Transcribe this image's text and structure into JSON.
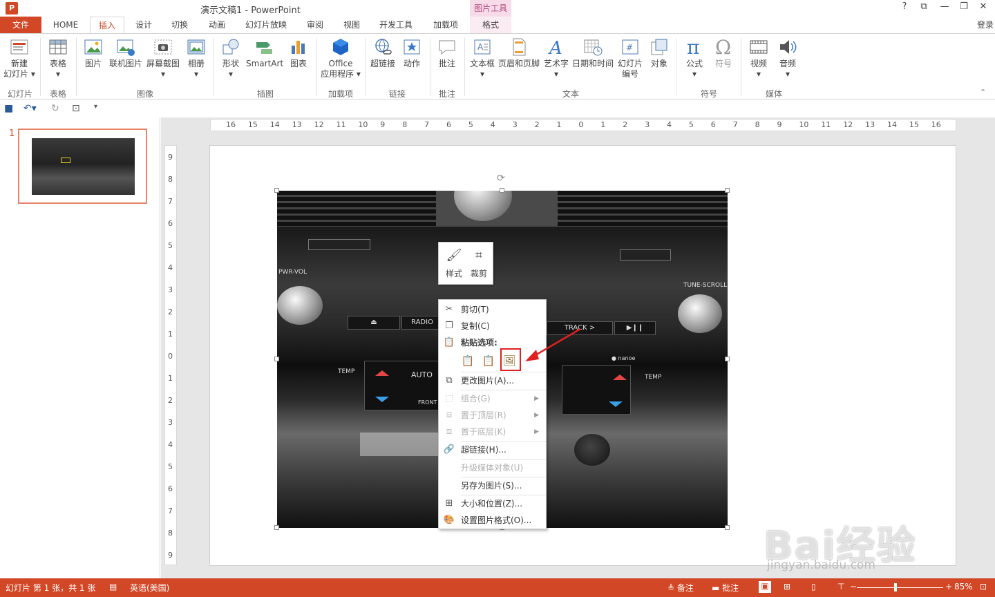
{
  "window": {
    "title": "演示文稿1 - PowerPoint",
    "context_tool": "图片工具",
    "help": "?",
    "minimize": "—",
    "restore": "❐",
    "close": "✕",
    "ribbon_display": "⧉"
  },
  "tabs": [
    {
      "label": "文件"
    },
    {
      "label": "HOME"
    },
    {
      "label": "插入"
    },
    {
      "label": "设计"
    },
    {
      "label": "切换"
    },
    {
      "label": "动画"
    },
    {
      "label": "幻灯片放映"
    },
    {
      "label": "审阅"
    },
    {
      "label": "视图"
    },
    {
      "label": "开发工具"
    },
    {
      "label": "加载项"
    },
    {
      "label": "格式"
    }
  ],
  "login": "登录",
  "ribbon": {
    "buttons": [
      {
        "label": "新建\n幻灯片 ▾"
      },
      {
        "label": "表格\n▾"
      },
      {
        "label": "图片"
      },
      {
        "label": "联机图片"
      },
      {
        "label": "屏幕截图\n▾"
      },
      {
        "label": "相册\n▾"
      },
      {
        "label": "形状\n▾"
      },
      {
        "label": "SmartArt"
      },
      {
        "label": "图表"
      },
      {
        "label": "Office\n应用程序 ▾"
      },
      {
        "label": "超链接"
      },
      {
        "label": "动作"
      },
      {
        "label": "批注"
      },
      {
        "label": "文本框\n▾"
      },
      {
        "label": "页眉和页脚"
      },
      {
        "label": "艺术字\n▾"
      },
      {
        "label": "日期和时间"
      },
      {
        "label": "幻灯片\n编号"
      },
      {
        "label": "对象"
      },
      {
        "label": "公式\n▾"
      },
      {
        "label": "符号"
      },
      {
        "label": "视频\n▾"
      },
      {
        "label": "音频\n▾"
      }
    ],
    "groups": [
      "幻灯片",
      "表格",
      "图像",
      "插图",
      "加载项",
      "链接",
      "批注",
      "文本",
      "符号",
      "媒体"
    ]
  },
  "ruler": {
    "horizontal": [
      "16",
      "15",
      "14",
      "13",
      "12",
      "11",
      "10",
      "9",
      "8",
      "7",
      "6",
      "5",
      "4",
      "3",
      "2",
      "1",
      "0",
      "1",
      "2",
      "3",
      "4",
      "5",
      "6",
      "7",
      "8",
      "9",
      "10",
      "11",
      "12",
      "13",
      "14",
      "15",
      "16"
    ],
    "vertical": [
      "9",
      "8",
      "7",
      "6",
      "5",
      "4",
      "3",
      "2",
      "1",
      "0",
      "1",
      "2",
      "3",
      "4",
      "5",
      "6",
      "7",
      "8",
      "9"
    ]
  },
  "slide_panel": {
    "number": "1"
  },
  "photo_text": {
    "pwr_vol": "PWR-VOL",
    "tune_scroll": "TUNE-SCROLL",
    "radio": "RADIO",
    "track": "TRACK >",
    "play": "▶❙❙",
    "eject": "⏏",
    "temp_left": "TEMP",
    "temp_right": "TEMP",
    "auto": "AUTO",
    "front": "FRONT",
    "nanoe": "● nanoe"
  },
  "mini_toolbar": {
    "style": "样式",
    "crop": "裁剪"
  },
  "context_menu": {
    "cut": "剪切(T)",
    "copy": "复制(C)",
    "paste_header": "粘贴选项:",
    "change_picture": "更改图片(A)...",
    "group": "组合(G)",
    "bring_front": "置于顶层(R)",
    "send_back": "置于底层(K)",
    "hyperlink": "超链接(H)...",
    "upgrade_media": "升级媒体对象(U)",
    "save_as_picture": "另存为图片(S)...",
    "size_position": "大小和位置(Z)...",
    "format_picture": "设置图片格式(O)..."
  },
  "status": {
    "slide_info": "幻灯片 第 1 张，共 1 张",
    "language": "英语(美国)",
    "notes": "备注",
    "comments": "批注",
    "zoom": "85%"
  },
  "watermark": {
    "logo": "Bai经验",
    "url": "jingyan.baidu.com"
  }
}
